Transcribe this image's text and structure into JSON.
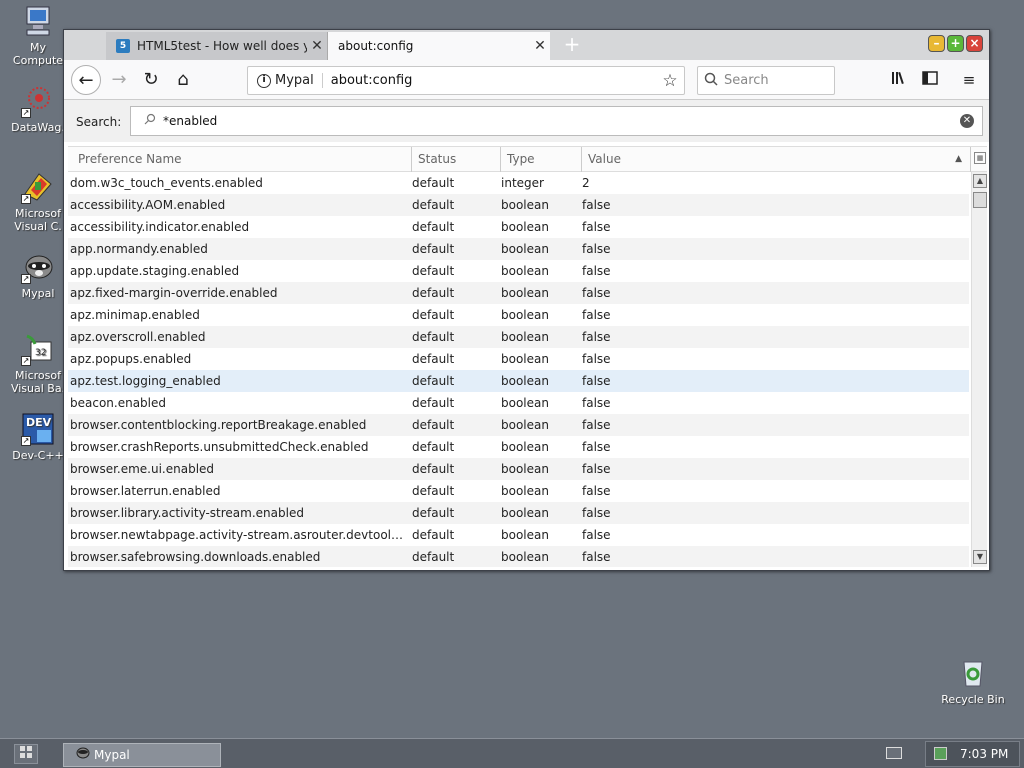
{
  "desktop": {
    "icons": [
      {
        "label": "My\nComputer",
        "line1": "My",
        "line2": "Compute",
        "icon": "computer-icon"
      },
      {
        "label": "DataWag...",
        "line1": "DataWag.",
        "line2": "",
        "icon": "datawag-icon"
      },
      {
        "label": "Microsoft Visual C...",
        "line1": "Microsof",
        "line2": "Visual C.",
        "icon": "visual-c-icon"
      },
      {
        "label": "Mypal",
        "line1": "Mypal",
        "line2": "",
        "icon": "mypal-icon"
      },
      {
        "label": "Microsoft Visual Basic",
        "line1": "Microsof",
        "line2": "Visual Ba.",
        "icon": "visual-basic-icon"
      },
      {
        "label": "Dev-C++",
        "line1": "Dev-C++",
        "line2": "",
        "icon": "devcpp-icon"
      }
    ],
    "recycle_bin": "Recycle Bin"
  },
  "browser": {
    "tabs": [
      {
        "title": "HTML5test - How well does y",
        "favicon": "5",
        "active": false
      },
      {
        "title": "about:config",
        "active": true
      }
    ],
    "new_tab_symbol": "+",
    "window_controls": {
      "min": "–",
      "max": "+",
      "close": "×"
    },
    "nav": {
      "back": "←",
      "forward": "→",
      "reload": "↻",
      "home": "⌂"
    },
    "urlbar": {
      "identity": "Mypal",
      "url": "about:config",
      "info": "i",
      "star": "☆"
    },
    "search": {
      "placeholder": "Search",
      "icon": "⚲"
    },
    "toolbar_icons": {
      "library": "|||\\",
      "sidebar": "▯",
      "menu": "≡"
    }
  },
  "config": {
    "search_label": "Search:",
    "filter_value": "*enabled",
    "columns": [
      "Preference Name",
      "Status",
      "Type",
      "Value"
    ],
    "rows": [
      {
        "name": "dom.w3c_touch_events.enabled",
        "status": "default",
        "type": "integer",
        "value": "2"
      },
      {
        "name": "accessibility.AOM.enabled",
        "status": "default",
        "type": "boolean",
        "value": "false"
      },
      {
        "name": "accessibility.indicator.enabled",
        "status": "default",
        "type": "boolean",
        "value": "false"
      },
      {
        "name": "app.normandy.enabled",
        "status": "default",
        "type": "boolean",
        "value": "false"
      },
      {
        "name": "app.update.staging.enabled",
        "status": "default",
        "type": "boolean",
        "value": "false"
      },
      {
        "name": "apz.fixed-margin-override.enabled",
        "status": "default",
        "type": "boolean",
        "value": "false"
      },
      {
        "name": "apz.minimap.enabled",
        "status": "default",
        "type": "boolean",
        "value": "false"
      },
      {
        "name": "apz.overscroll.enabled",
        "status": "default",
        "type": "boolean",
        "value": "false"
      },
      {
        "name": "apz.popups.enabled",
        "status": "default",
        "type": "boolean",
        "value": "false"
      },
      {
        "name": "apz.test.logging_enabled",
        "status": "default",
        "type": "boolean",
        "value": "false"
      },
      {
        "name": "beacon.enabled",
        "status": "default",
        "type": "boolean",
        "value": "false"
      },
      {
        "name": "browser.contentblocking.reportBreakage.enabled",
        "status": "default",
        "type": "boolean",
        "value": "false"
      },
      {
        "name": "browser.crashReports.unsubmittedCheck.enabled",
        "status": "default",
        "type": "boolean",
        "value": "false"
      },
      {
        "name": "browser.eme.ui.enabled",
        "status": "default",
        "type": "boolean",
        "value": "false"
      },
      {
        "name": "browser.laterrun.enabled",
        "status": "default",
        "type": "boolean",
        "value": "false"
      },
      {
        "name": "browser.library.activity-stream.enabled",
        "status": "default",
        "type": "boolean",
        "value": "false"
      },
      {
        "name": "browser.newtabpage.activity-stream.asrouter.devtoolsEn...",
        "status": "default",
        "type": "boolean",
        "value": "false"
      },
      {
        "name": "browser.safebrowsing.downloads.enabled",
        "status": "default",
        "type": "boolean",
        "value": "false"
      }
    ],
    "selected_row": 9
  },
  "taskbar": {
    "task_label": "Mypal",
    "clock": "7:03 PM"
  }
}
